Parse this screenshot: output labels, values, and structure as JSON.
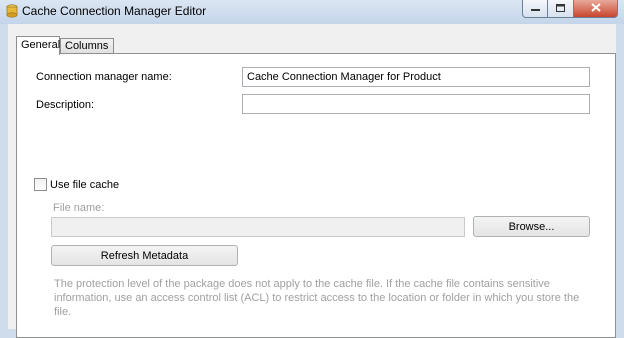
{
  "window": {
    "title": "Cache Connection Manager Editor",
    "icons": {
      "app": "ssis-connection-icon",
      "minimize": "minimize-icon",
      "maximize": "maximize-icon",
      "close": "close-icon"
    }
  },
  "tabs": [
    {
      "label": "General",
      "active": true
    },
    {
      "label": "Columns",
      "active": false
    }
  ],
  "general": {
    "connection_name_label": "Connection manager name:",
    "connection_name_value": "Cache Connection Manager for Product",
    "description_label": "Description:",
    "description_value": "",
    "use_file_cache_label": "Use file cache",
    "use_file_cache_checked": false,
    "file_name_label": "File name:",
    "file_name_value": "",
    "browse_label": "Browse...",
    "refresh_label": "Refresh Metadata",
    "protection_note": "The protection level of the package does not apply to the cache file. If the cache file contains sensitive information, use an access control list (ACL) to restrict access to the location or folder in which you store the file."
  }
}
